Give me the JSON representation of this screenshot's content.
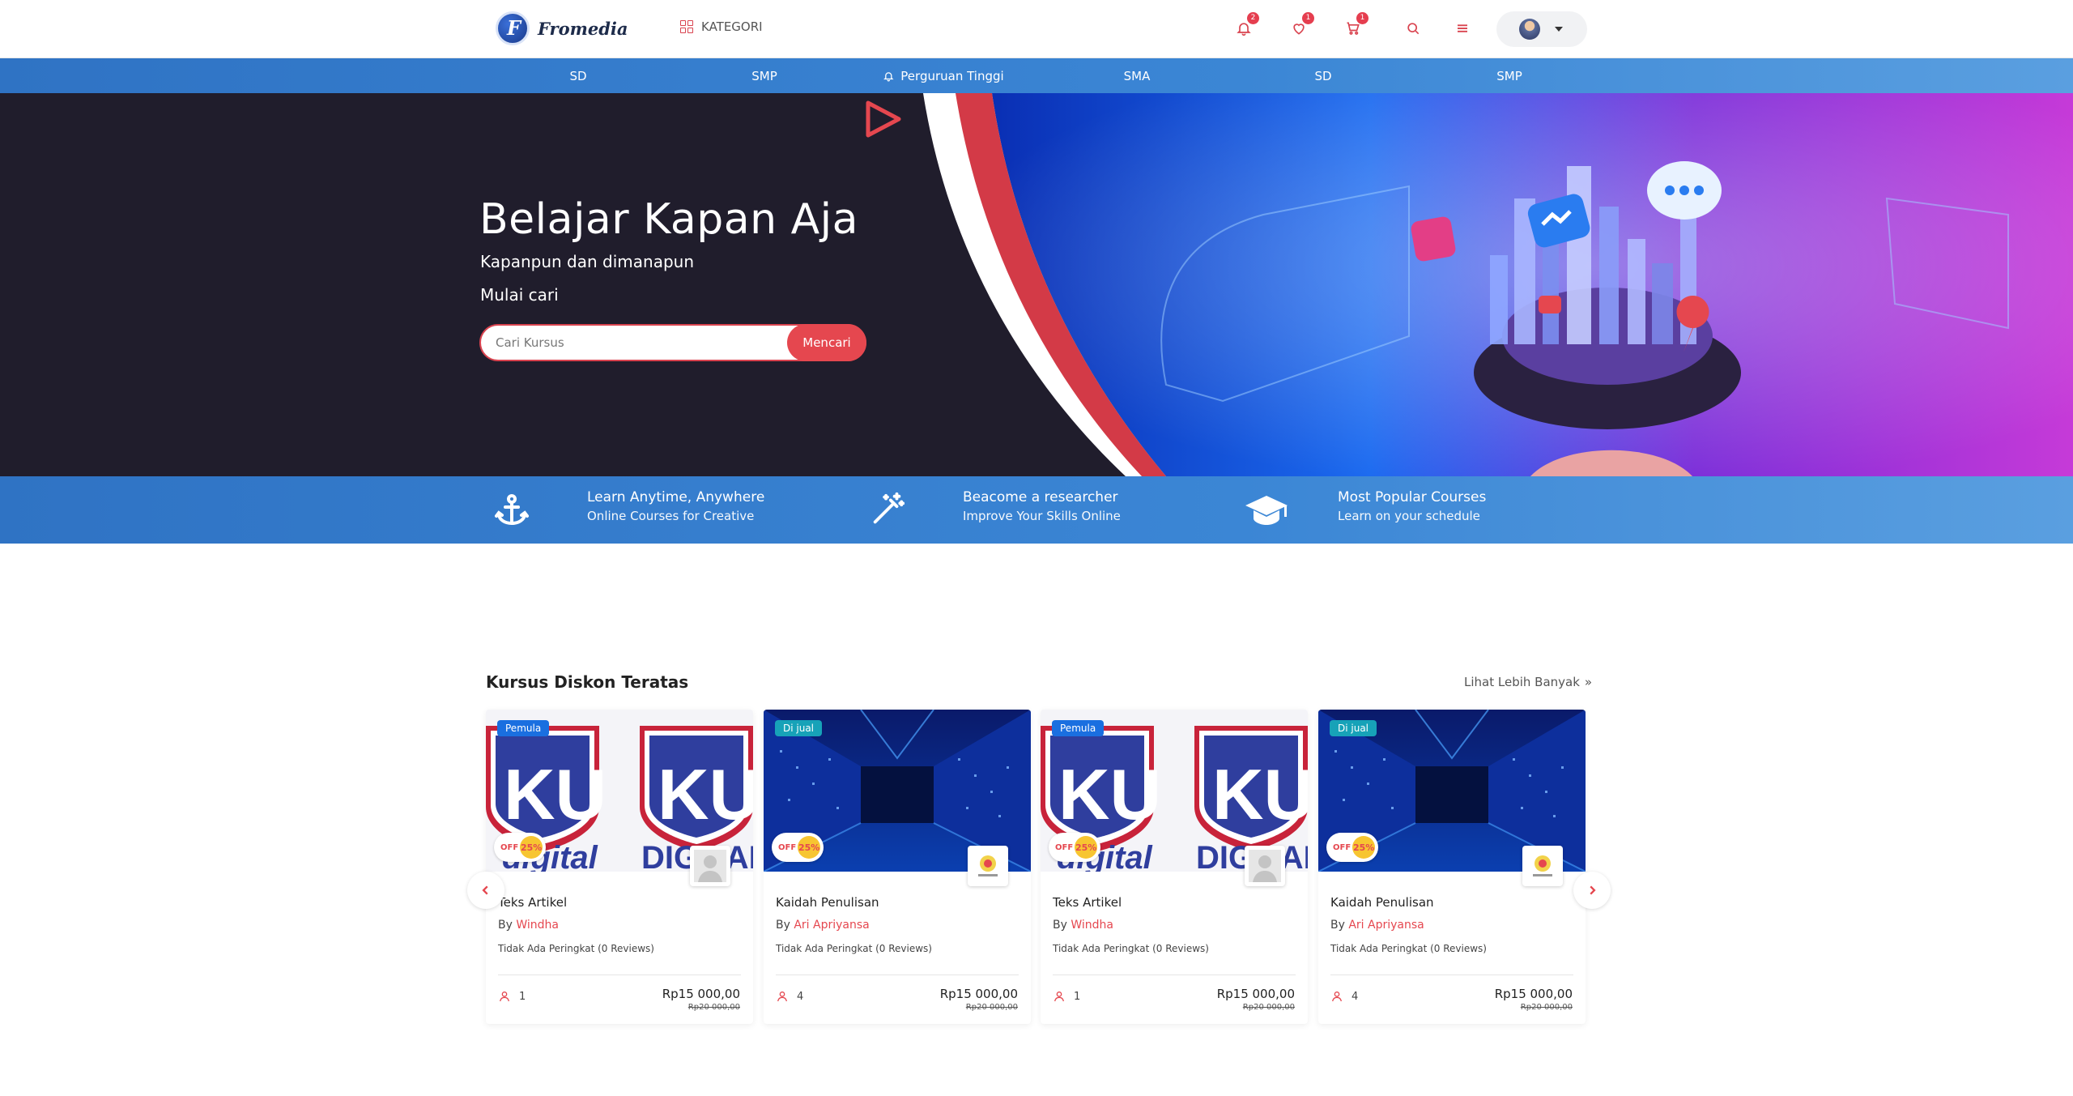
{
  "header": {
    "brand": "Fromedia",
    "kategori_label": "KATEGORI",
    "badges": {
      "notifications": "2",
      "wishlist": "1",
      "cart": "1"
    },
    "icons": [
      "bell-icon",
      "heart-icon",
      "cart-icon",
      "search-icon",
      "menu-icon"
    ]
  },
  "category_nav": [
    {
      "label": "SD"
    },
    {
      "label": "SMP"
    },
    {
      "label": "Perguruan Tinggi",
      "icon": "bell-icon"
    },
    {
      "label": "SMA"
    },
    {
      "label": "SD"
    },
    {
      "label": "SMP"
    }
  ],
  "hero": {
    "title": "Belajar Kapan Aja",
    "subtitle": "Kapanpun dan dimanapun",
    "subtitle2": "Mulai cari",
    "search_placeholder": "Cari Kursus",
    "search_button": "Mencari"
  },
  "features": [
    {
      "icon": "anchor-icon",
      "title": "Learn Anytime, Anywhere",
      "subtitle": "Online Courses for Creative"
    },
    {
      "icon": "magic-wand-icon",
      "title": "Beacome a researcher",
      "subtitle": "Improve Your Skills Online"
    },
    {
      "icon": "graduation-cap-icon",
      "title": "Most Popular Courses",
      "subtitle": "Learn on your schedule"
    }
  ],
  "section": {
    "title": "Kursus Diskon Teratas",
    "see_more": "Lihat Lebih Banyak"
  },
  "courses": [
    {
      "tag": "Pemula",
      "off_label": "OFF",
      "discount": "25%",
      "title": "Teks Artikel",
      "by": "By",
      "author": "Windha",
      "rating": "Tidak Ada Peringkat (0 Reviews)",
      "students": "1",
      "price": "Rp15 000,00",
      "old_price": "Rp20 000,00"
    },
    {
      "tag": "Di jual",
      "off_label": "OFF",
      "discount": "25%",
      "title": "Kaidah Penulisan",
      "by": "By",
      "author": "Ari Apriyansa",
      "rating": "Tidak Ada Peringkat (0 Reviews)",
      "students": "4",
      "price": "Rp15 000,00",
      "old_price": "Rp20 000,00"
    },
    {
      "tag": "Pemula",
      "off_label": "OFF",
      "discount": "25%",
      "title": "Teks Artikel",
      "by": "By",
      "author": "Windha",
      "rating": "Tidak Ada Peringkat (0 Reviews)",
      "students": "1",
      "price": "Rp15 000,00",
      "old_price": "Rp20 000,00"
    },
    {
      "tag": "Di jual",
      "off_label": "OFF",
      "discount": "25%",
      "title": "Kaidah Penulisan",
      "by": "By",
      "author": "Ari Apriyansa",
      "rating": "Tidak Ada Peringkat (0 Reviews)",
      "students": "4",
      "price": "Rp15 000,00",
      "old_price": "Rp20 000,00"
    }
  ],
  "colors": {
    "accent": "#e5474f",
    "nav_blue": "#2f73c4",
    "hero_dark": "#1f1c2b"
  }
}
